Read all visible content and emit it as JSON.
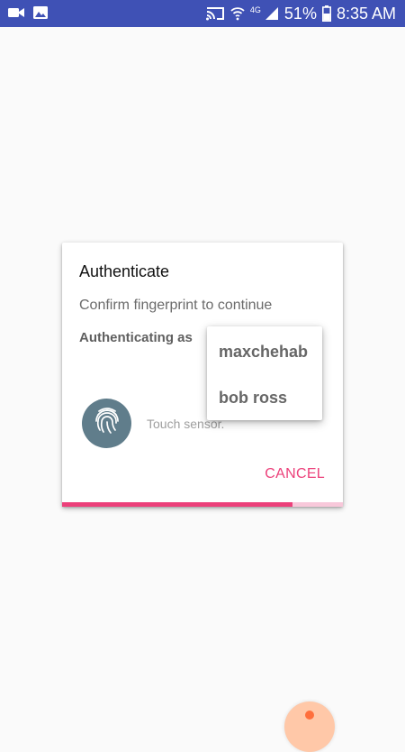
{
  "status_bar": {
    "network_label": "4G",
    "battery": "51%",
    "time": "8:35 AM",
    "icons": [
      "video-camera-icon",
      "image-icon",
      "cast-icon",
      "wifi-icon",
      "signal-icon",
      "battery-icon"
    ]
  },
  "dialog": {
    "title": "Authenticate",
    "subtitle": "Confirm fingerprint to continue",
    "auth_label": "Authenticating as",
    "sensor_text": "Touch sensor.",
    "cancel_label": "CANCEL",
    "progress_percent": 82,
    "accent_color": "#ec407a",
    "icon_bg_color": "#607d8b"
  },
  "menu": {
    "items": [
      "maxchehab",
      "bob ross"
    ]
  },
  "colors": {
    "status_bar": "#3f51b5",
    "background": "#fafafa",
    "fab": "#ffc8a8"
  }
}
